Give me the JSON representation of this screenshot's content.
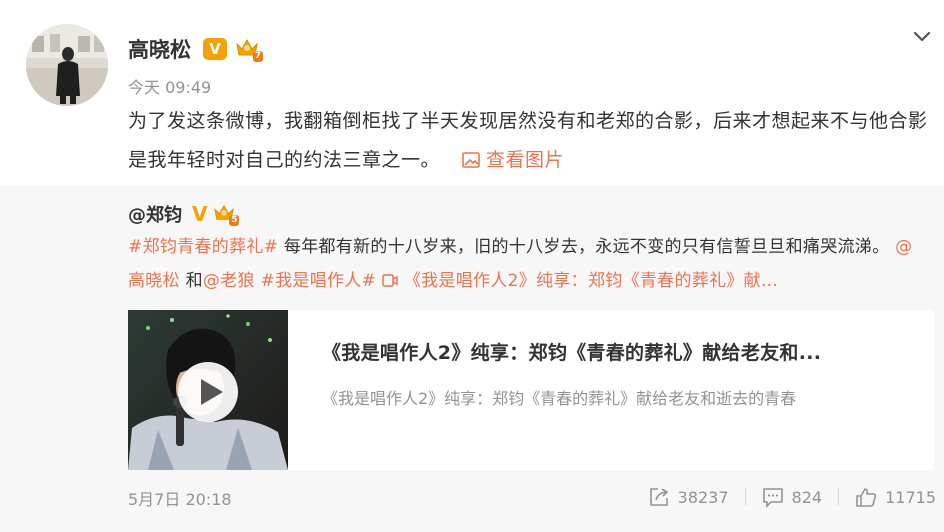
{
  "post": {
    "author": "高晓松",
    "time": "今天 09:49",
    "text": "为了发这条微博，我翻箱倒柜找了半天发现居然没有和老郑的合影，后来才想起来不与他合影是我年轻时对自己的约法三章之一。",
    "view_pictures": "查看图片"
  },
  "retweet": {
    "author": "@郑钧",
    "topic": "#郑钧青春的葬礼#",
    "text": " 每年都有新的十八岁来，旧的十八岁去，永远不变的只有信誓旦旦和痛哭流涕。",
    "mention1": "@高晓松",
    "and": " 和",
    "mention2": "@老狼",
    "topic2": "#我是唱作人#",
    "video_link": "《我是唱作人2》纯享：郑钧《青春的葬礼》献...",
    "card": {
      "title": "《我是唱作人2》纯享：郑钧《青春的葬礼》献给老友和...",
      "desc": "《我是唱作人2》纯享：郑钧《青春的葬礼》献给老友和逝去的青春"
    },
    "time": "5月7日 20:18",
    "reposts": "38237",
    "comments": "824",
    "likes": "11715"
  },
  "colors": {
    "accent": "#eb7350",
    "muted": "#939393",
    "retweet_bg": "#f7f7f7",
    "verified": "#f4a007"
  },
  "icons": [
    "chevron-down-icon",
    "picture-icon",
    "video-icon",
    "play-icon",
    "repost-icon",
    "comment-icon",
    "like-icon",
    "crown-icon"
  ]
}
